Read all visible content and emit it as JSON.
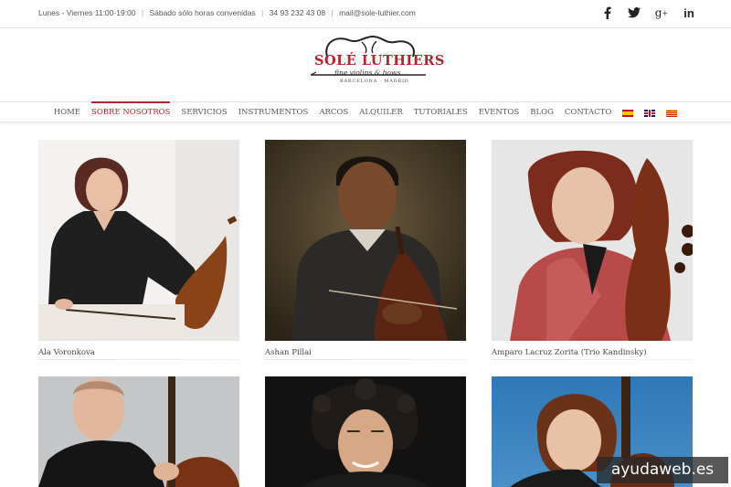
{
  "topbar": {
    "hours": "Lunes - Viernes 11:00-19:00",
    "saturday": "Sábado sólo horas convenidas",
    "phone": "34 93 232 43 08",
    "email": "mail@sole-luthier.com",
    "separator": "|",
    "social": [
      {
        "name": "facebook-icon",
        "glyph": "f"
      },
      {
        "name": "twitter-icon",
        "glyph": "t"
      },
      {
        "name": "google-plus-icon",
        "glyph": "g+"
      },
      {
        "name": "linkedin-icon",
        "glyph": "in"
      }
    ]
  },
  "logo": {
    "brand": "SOLÉ LUTHIERS",
    "tagline": "fine violins & bows",
    "cities": "BARCELONA · MADRID",
    "brand_color": "#b3242b"
  },
  "nav": {
    "items": [
      "HOME",
      "SOBRE NOSOTROS",
      "SERVICIOS",
      "INSTRUMENTOS",
      "ARCOS",
      "ALQUILER",
      "TUTORIALES",
      "EVENTOS",
      "BLOG",
      "CONTACTO"
    ],
    "active": "SOBRE NOSOTROS",
    "accent": "#b3242b",
    "languages": [
      "español-flag-icon",
      "english-flag-icon",
      "catalan-flag-icon"
    ]
  },
  "gallery": [
    {
      "name": "Ala Voronkova"
    },
    {
      "name": "Ashan Pillai"
    },
    {
      "name": "Amparo Lacruz Zorita (Trio Kandinsky)"
    },
    {
      "name": ""
    },
    {
      "name": ""
    },
    {
      "name": ""
    }
  ],
  "watermark": "ayudaweb.es"
}
